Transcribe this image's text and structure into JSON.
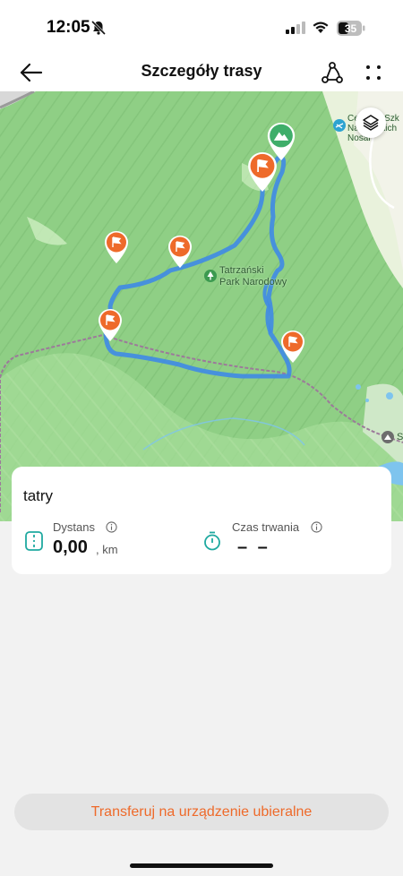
{
  "status_bar": {
    "time": "12:05",
    "battery": "35"
  },
  "nav": {
    "title": "Szczegóły trasy"
  },
  "map": {
    "labels": {
      "park": [
        "Tatrzański",
        "Park Narodowy"
      ],
      "top_right": [
        "Centrum Szk",
        "Narciarskich",
        "Nosal"
      ],
      "bottom_right": "S"
    }
  },
  "card": {
    "title": "tatry",
    "distance": {
      "label": "Dystans",
      "value": "0,00",
      "unit": ", km"
    },
    "duration": {
      "label": "Czas trwania",
      "value": "– –"
    }
  },
  "footer": {
    "transfer_label": "Transferuj na urządzenie ubieralne"
  },
  "colors": {
    "accent": "#ee6a2a",
    "route": "#3f8ae6",
    "start_pin": "#3fae6a"
  }
}
